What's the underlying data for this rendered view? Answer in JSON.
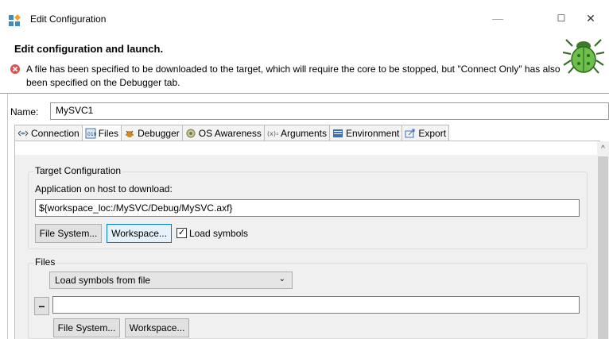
{
  "window": {
    "title": "Edit Configuration",
    "minimize_glyph": "—",
    "maximize_glyph": "☐",
    "close_glyph": "✕"
  },
  "header": {
    "title": "Edit configuration and launch.",
    "message": "A file has been specified to be downloaded to the target, which will require the core to be stopped, but \"Connect Only\" has also been specified on the Debugger tab."
  },
  "name": {
    "label": "Name:",
    "value": "MySVC1"
  },
  "tabs": [
    {
      "label": "Connection",
      "icon": "connection-icon",
      "active": false
    },
    {
      "label": "Files",
      "icon": "files-icon",
      "active": true
    },
    {
      "label": "Debugger",
      "icon": "debugger-icon",
      "active": false
    },
    {
      "label": "OS Awareness",
      "icon": "os-awareness-icon",
      "active": false
    },
    {
      "label": "Arguments",
      "icon": "arguments-icon",
      "active": false
    },
    {
      "label": "Environment",
      "icon": "environment-icon",
      "active": false
    },
    {
      "label": "Export",
      "icon": "export-icon",
      "active": false
    }
  ],
  "target_config": {
    "legend": "Target Configuration",
    "app_label": "Application on host to download:",
    "app_path": "${workspace_loc:/MySVC/Debug/MySVC.axf}",
    "file_system_btn": "File System...",
    "workspace_btn": "Workspace...",
    "load_symbols_label": "Load symbols",
    "load_symbols_checked": "✓"
  },
  "files": {
    "legend": "Files",
    "dropdown_value": "Load symbols from file",
    "minus_label": "−",
    "file_value": "",
    "file_system_btn": "File System...",
    "workspace_btn": "Workspace..."
  },
  "colors": {
    "error": "#c0392b",
    "focus": "#0078d7",
    "bug": "#5cb85c"
  }
}
